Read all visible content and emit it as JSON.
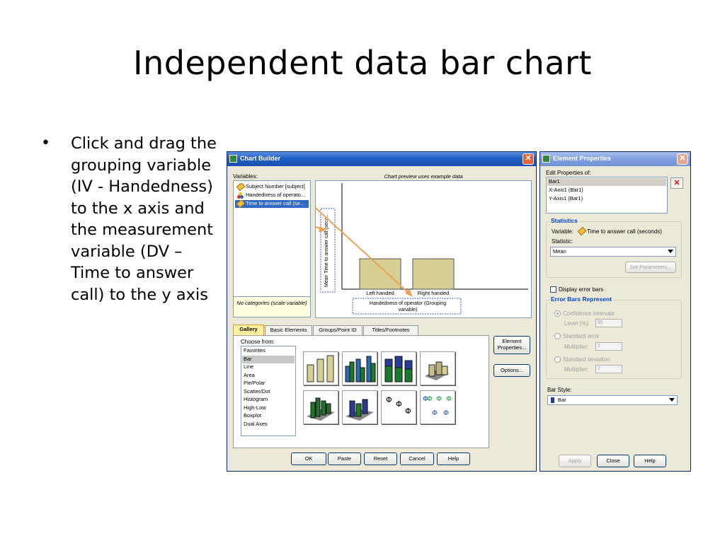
{
  "slide": {
    "title": "Independent data bar chart",
    "bullet": "Click and drag the grouping variable (IV - Handedness) to the x axis and the measurement variable (DV – Time to answer call) to the y axis"
  },
  "chart_builder": {
    "title": "Chart Builder",
    "variables_label": "Variables:",
    "variables": [
      {
        "label": "Subject Number [subject]",
        "type": "scale",
        "selected": false
      },
      {
        "label": "Handedness of operato...",
        "type": "nominal",
        "selected": false
      },
      {
        "label": "Time to answer call (se...",
        "type": "scale",
        "selected": true
      }
    ],
    "no_categories": "No categories (scale variable)",
    "preview_caption": "Chart preview uses example data",
    "y_axis_label": "Mean Time to answer call (seco...",
    "categories": [
      "Left handed",
      "Right handed"
    ],
    "x_axis_label": "Handedness of operator (Grouping variable)",
    "tabs": [
      "Gallery",
      "Basic Elements",
      "Groups/Point ID",
      "Titles/Footnotes"
    ],
    "active_tab": "Gallery",
    "choose_from_label": "Choose from:",
    "chart_types": [
      "Favorites",
      "Bar",
      "Line",
      "Area",
      "Pie/Polar",
      "Scatter/Dot",
      "Histogram",
      "High-Low",
      "Boxplot",
      "Dual Axes"
    ],
    "selected_chart_type": "Bar",
    "side_buttons": {
      "element_properties": "Element Properties...",
      "options": "Options..."
    },
    "bottom_buttons": [
      "OK",
      "Paste",
      "Reset",
      "Cancel",
      "Help"
    ],
    "colors": {
      "bar_fill": "#d6cf94",
      "arrow": "#f0a050",
      "title_bar": "#1f5fc8"
    }
  },
  "element_properties": {
    "title": "Element Properties",
    "edit_label": "Edit Properties of:",
    "elements": [
      "Bar1",
      "X-Axis1 (Bar1)",
      "Y-Axis1 (Bar1)"
    ],
    "selected_element": "Bar1",
    "statistics_title": "Statistics",
    "variable_label": "Variable:",
    "variable_value": "Time to answer call (seconds)",
    "statistic_label": "Statistic:",
    "statistic_value": "Mean",
    "set_parameters": "Set Parameters...",
    "display_error_bars": "Display error bars",
    "error_bars_title": "Error Bars Represent",
    "confidence_intervals": "Confidence intervals",
    "level_label": "Level (%):",
    "level_value": "95",
    "standard_error": "Standard error",
    "multiplier_label": "Multiplier:",
    "multiplier_value": "2",
    "standard_deviation": "Standard deviation",
    "bar_style_label": "Bar Style:",
    "bar_style_value": "Bar",
    "buttons": [
      "Apply",
      "Close",
      "Help"
    ]
  }
}
